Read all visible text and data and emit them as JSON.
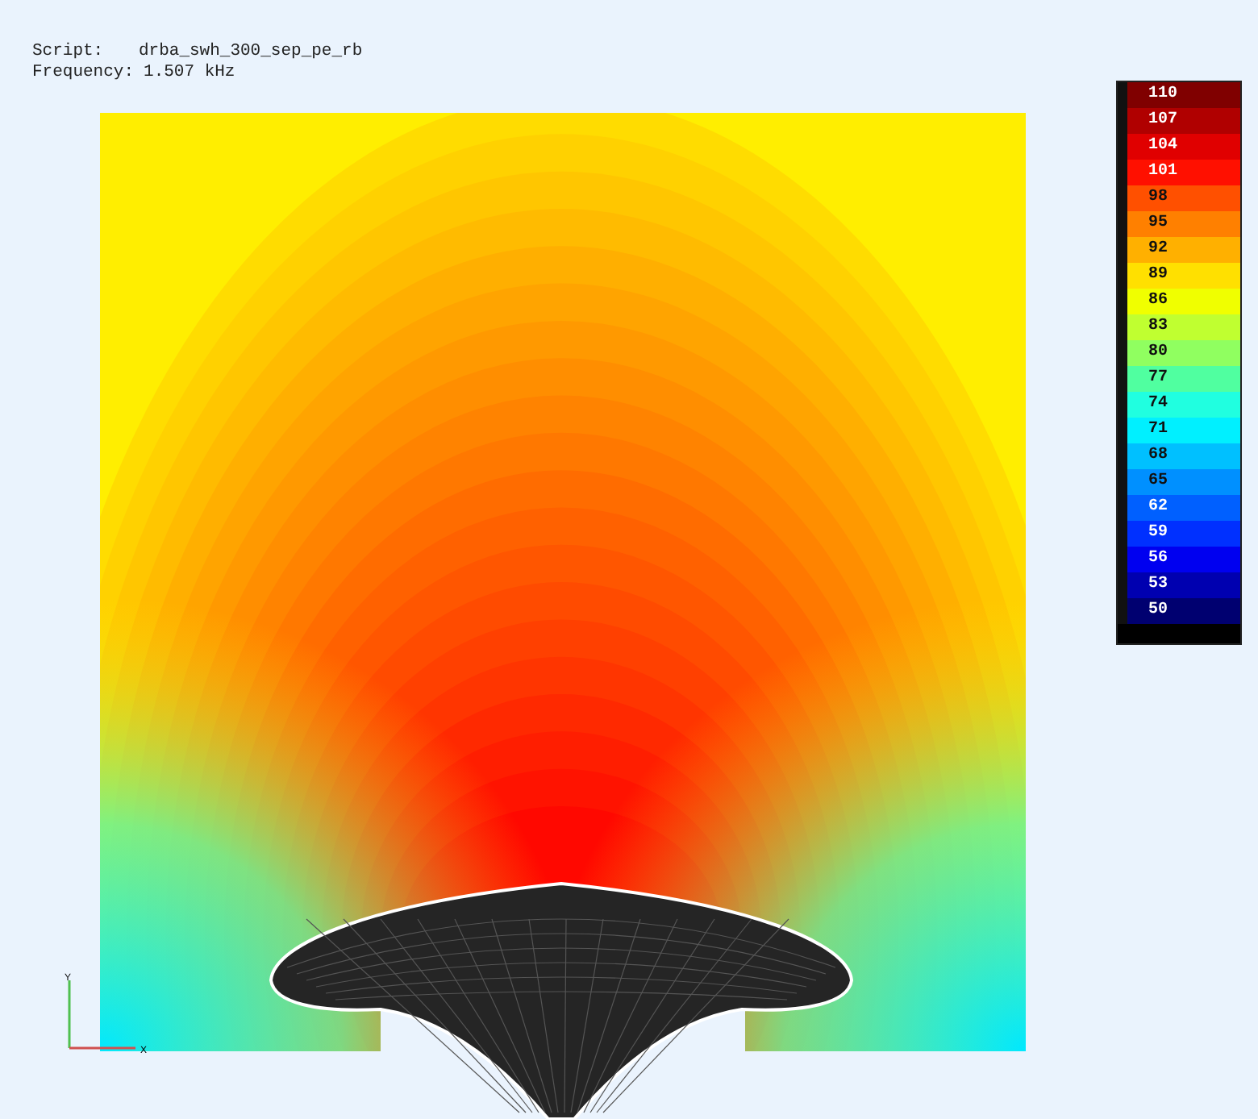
{
  "header": {
    "script_label": "Script:",
    "script_value": "drba_swh_300_sep_pe_rb",
    "frequency_label": "Frequency:",
    "frequency_value": "1.507 kHz"
  },
  "legend": {
    "labels": [
      "110",
      "107",
      "104",
      "101",
      "98",
      "95",
      "92",
      "89",
      "86",
      "83",
      "80",
      "77",
      "74",
      "71",
      "68",
      "65",
      "62",
      "59",
      "56",
      "53",
      "50"
    ]
  },
  "axes": {
    "x_label": "X",
    "y_label": "Y"
  }
}
